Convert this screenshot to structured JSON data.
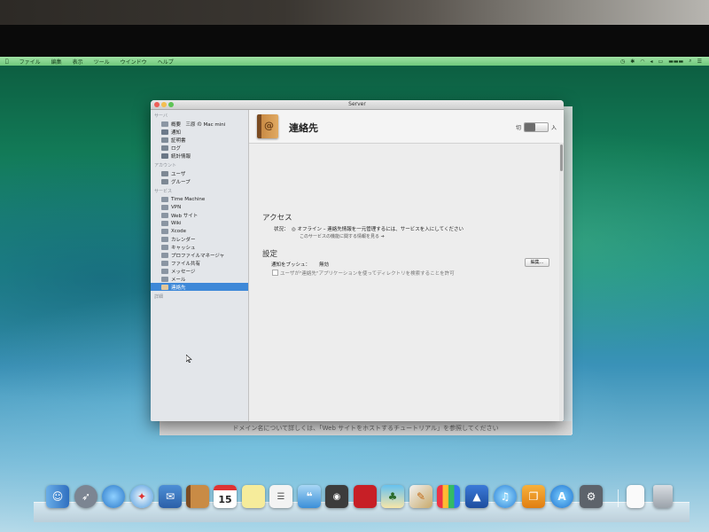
{
  "menubar": {
    "items": [
      "ファイル",
      "編集",
      "表示",
      "ツール",
      "ウインドウ",
      "ヘルプ"
    ]
  },
  "window": {
    "title": "Server"
  },
  "sidebar": {
    "sections": {
      "server": "サーバ",
      "accounts": "アカウント",
      "services": "サービス",
      "advanced": "詳細"
    },
    "server_items": [
      "概要　三原 の Mac mini",
      "通知",
      "証明書",
      "ログ",
      "統計情報"
    ],
    "account_items": [
      "ユーザ",
      "グループ"
    ],
    "service_items": [
      "Time Machine",
      "VPN",
      "Web サイト",
      "Wiki",
      "Xcode",
      "カレンダー",
      "キャッシュ",
      "プロファイルマネージャ",
      "ファイル共有",
      "メッセージ",
      "メール",
      "連絡先"
    ]
  },
  "main": {
    "service_title": "連絡先",
    "toggle_off": "切",
    "toggle_on": "入",
    "access_heading": "アクセス",
    "status_label": "状況：",
    "status_text": "◎ オフライン – 連絡先情報を一元管理するには、サービスを入にしてください",
    "status_link": "このサービスの機能に関する情報を見る",
    "settings_heading": "設定",
    "push_label": "通知をプッシュ：",
    "push_value": "無効",
    "edit_button": "編集...",
    "allow_directory_search": "ユーザが\"連絡先\"アプリケーションを使ってディレクトリを検索することを許可"
  },
  "behind_window_text": "ドメイン名について詳しくは、「Web サイトをホストするチュートリアル」を参照してください",
  "dock": {
    "calendar_day": "15"
  },
  "colors": {
    "selection": "#3d88d8",
    "menubar": "#8fd898"
  }
}
